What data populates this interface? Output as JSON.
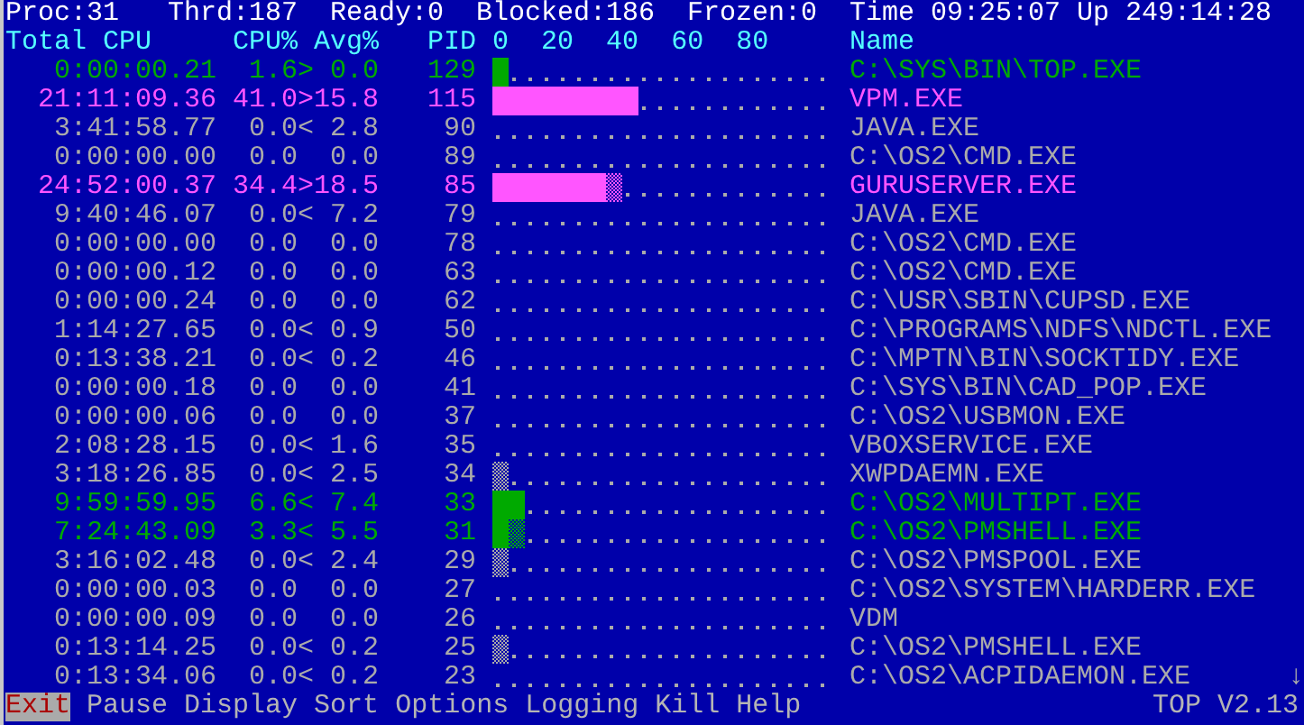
{
  "status": [
    "Proc:31",
    "Thrd:187",
    "Ready:0",
    "Blocked:186",
    "Frozen:0",
    "Time 09:25:07",
    "Up 249:14:28"
  ],
  "columns": {
    "total_cpu": "Total CPU",
    "cpu_percent": "CPU%",
    "avg_percent": "Avg%",
    "pid": "PID",
    "scale_ticks": [
      "0",
      "20",
      "40",
      "60",
      "80"
    ],
    "name": "Name"
  },
  "processes": [
    {
      "cpu_time": "0:00:00.21",
      "cpu": "1.6",
      "trend": ">",
      "avg": "0.0",
      "pid": "129",
      "level": 0.05,
      "partial": false,
      "name": "C:\\SYS\\BIN\\TOP.EXE",
      "color": "#00aa00"
    },
    {
      "cpu_time": "21:11:09.36",
      "cpu": "41.0",
      "trend": ">",
      "avg": "15.8",
      "pid": "115",
      "level": 0.45,
      "partial": false,
      "name": "VPM.EXE",
      "color": "#ff55ff"
    },
    {
      "cpu_time": "3:41:58.77",
      "cpu": "0.0",
      "trend": "<",
      "avg": "2.8",
      "pid": "90",
      "partial": false,
      "name": "JAVA.EXE",
      "color": "#aaaaaa"
    },
    {
      "cpu_time": "0:00:00.00",
      "cpu": "0.0",
      "avg": "0.0",
      "pid": "89",
      "partial": false,
      "name": "C:\\OS2\\CMD.EXE",
      "color": "#aaaaaa"
    },
    {
      "cpu_time": "24:52:00.37",
      "cpu": "34.4",
      "trend": ">",
      "avg": "18.5",
      "pid": "85",
      "level": 0.35,
      "partial": true,
      "name": "GURUSERVER.EXE",
      "color": "#ff55ff"
    },
    {
      "cpu_time": "9:40:46.07",
      "cpu": "0.0",
      "trend": "<",
      "avg": "7.2",
      "pid": "79",
      "partial": false,
      "name": "JAVA.EXE",
      "color": "#aaaaaa"
    },
    {
      "cpu_time": "0:00:00.00",
      "cpu": "0.0",
      "avg": "0.0",
      "pid": "78",
      "partial": false,
      "name": "C:\\OS2\\CMD.EXE",
      "color": "#aaaaaa"
    },
    {
      "cpu_time": "0:00:00.12",
      "cpu": "0.0",
      "avg": "0.0",
      "pid": "63",
      "partial": false,
      "name": "C:\\OS2\\CMD.EXE",
      "color": "#aaaaaa"
    },
    {
      "cpu_time": "0:00:00.24",
      "cpu": "0.0",
      "avg": "0.0",
      "pid": "62",
      "partial": false,
      "name": "C:\\USR\\SBIN\\CUPSD.EXE",
      "color": "#aaaaaa"
    },
    {
      "cpu_time": "1:14:27.65",
      "cpu": "0.0",
      "trend": "<",
      "avg": "0.9",
      "pid": "50",
      "partial": false,
      "name": "C:\\PROGRAMS\\NDFS\\NDCTL.EXE",
      "color": "#aaaaaa"
    },
    {
      "cpu_time": "0:13:38.21",
      "cpu": "0.0",
      "trend": "<",
      "avg": "0.2",
      "pid": "46",
      "partial": false,
      "name": "C:\\MPTN\\BIN\\SOCKTIDY.EXE",
      "color": "#aaaaaa"
    },
    {
      "cpu_time": "0:00:00.18",
      "cpu": "0.0",
      "avg": "0.0",
      "pid": "41",
      "partial": false,
      "name": "C:\\SYS\\BIN\\CAD_POP.EXE",
      "color": "#aaaaaa"
    },
    {
      "cpu_time": "0:00:00.06",
      "cpu": "0.0",
      "avg": "0.0",
      "pid": "37",
      "partial": false,
      "name": "C:\\OS2\\USBMON.EXE",
      "color": "#aaaaaa"
    },
    {
      "cpu_time": "2:08:28.15",
      "cpu": "0.0",
      "trend": "<",
      "avg": "1.6",
      "pid": "35",
      "partial": false,
      "name": "VBOXSERVICE.EXE",
      "color": "#aaaaaa"
    },
    {
      "cpu_time": "3:18:26.85",
      "cpu": "0.0",
      "trend": "<",
      "avg": "2.5",
      "pid": "34",
      "partial": true,
      "name": "XWPDAEMN.EXE",
      "color": "#aaaaaa"
    },
    {
      "cpu_time": "9:59:59.95",
      "cpu": "6.6",
      "trend": "<",
      "avg": "7.4",
      "pid": "33",
      "level": 0.1,
      "partial": false,
      "name": "C:\\OS2\\MULTIPT.EXE",
      "color": "#00aa00"
    },
    {
      "cpu_time": "7:24:43.09",
      "cpu": "3.3",
      "trend": "<",
      "avg": "5.5",
      "pid": "31",
      "level": 0.05,
      "partial": true,
      "name": "C:\\OS2\\PMSHELL.EXE",
      "color": "#00aa00"
    },
    {
      "cpu_time": "3:16:02.48",
      "cpu": "0.0",
      "trend": "<",
      "avg": "2.4",
      "pid": "29",
      "partial": true,
      "name": "C:\\OS2\\PMSPOOL.EXE",
      "color": "#aaaaaa"
    },
    {
      "cpu_time": "0:00:00.03",
      "cpu": "0.0",
      "avg": "0.0",
      "pid": "27",
      "partial": false,
      "name": "C:\\OS2\\SYSTEM\\HARDERR.EXE",
      "color": "#aaaaaa"
    },
    {
      "cpu_time": "0:00:00.09",
      "cpu": "0.0",
      "avg": "0.0",
      "pid": "26",
      "partial": false,
      "name": "VDM",
      "color": "#aaaaaa"
    },
    {
      "cpu_time": "0:13:14.25",
      "cpu": "0.0",
      "trend": "<",
      "avg": "0.2",
      "pid": "25",
      "partial": true,
      "name": "C:\\OS2\\PMSHELL.EXE",
      "color": "#aaaaaa"
    },
    {
      "cpu_time": "0:13:34.06",
      "cpu": "0.0",
      "trend": "<",
      "avg": "0.2",
      "pid": "23",
      "partial": false,
      "name": "C:\\OS2\\ACPIDAEMON.EXE",
      "color": "#aaaaaa"
    }
  ],
  "scroll_indicator": "↓",
  "menu": [
    {
      "label": "Exit",
      "selected": true
    },
    {
      "label": "Pause",
      "selected": false
    },
    {
      "label": "Display",
      "selected": false
    },
    {
      "label": "Sort",
      "selected": false
    },
    {
      "label": "Options",
      "selected": false
    },
    {
      "label": "Logging",
      "selected": false
    },
    {
      "label": "Kill",
      "selected": false
    },
    {
      "label": "Help",
      "selected": false
    }
  ],
  "version": "TOP V2.13"
}
